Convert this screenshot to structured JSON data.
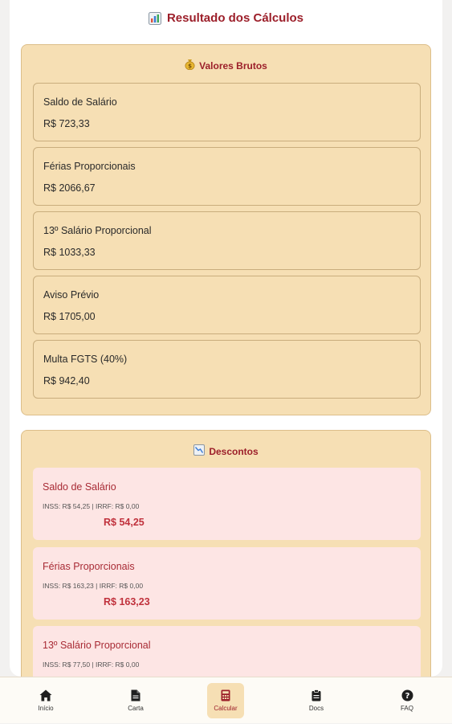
{
  "header": {
    "title": "Resultado dos Cálculos",
    "icon": "bar-chart-icon"
  },
  "gross": {
    "heading": "Valores Brutos",
    "icon": "money-bag-icon",
    "items": [
      {
        "label": "Saldo de Salário",
        "value": "R$ 723,33"
      },
      {
        "label": "Férias Proporcionais",
        "value": "R$ 2066,67"
      },
      {
        "label": "13º Salário Proporcional",
        "value": "R$ 1033,33"
      },
      {
        "label": "Aviso Prévio",
        "value": "R$ 1705,00"
      },
      {
        "label": "Multa FGTS (40%)",
        "value": "R$ 942,40"
      }
    ]
  },
  "deductions": {
    "heading": "Descontos",
    "icon": "chart-down-icon",
    "items": [
      {
        "label": "Saldo de Salário",
        "detail": "INSS: R$ 54,25 | IRRF: R$ 0,00",
        "total": "R$ 54,25"
      },
      {
        "label": "Férias Proporcionais",
        "detail": "INSS: R$ 163,23 | IRRF: R$ 0,00",
        "total": "R$ 163,23"
      },
      {
        "label": "13º Salário Proporcional",
        "detail": "INSS: R$ 77,50 | IRRF: R$ 0,00",
        "total": ""
      }
    ]
  },
  "nav": [
    {
      "label": "Início",
      "icon": "home-icon"
    },
    {
      "label": "Carta",
      "icon": "document-icon"
    },
    {
      "label": "Calcular",
      "icon": "calculator-icon",
      "active": true
    },
    {
      "label": "Docs",
      "icon": "clipboard-icon"
    },
    {
      "label": "FAQ",
      "icon": "question-icon"
    }
  ],
  "colors": {
    "accent": "#9c1f2a",
    "panel": "#f6dfb4",
    "deduction_card": "#fde5e4"
  }
}
